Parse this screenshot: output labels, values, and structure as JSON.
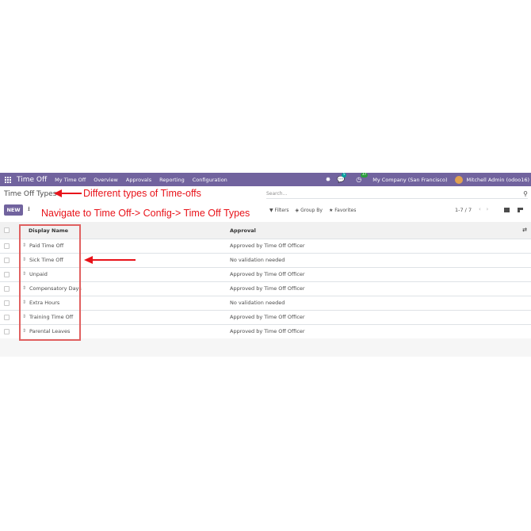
{
  "navbar": {
    "brand": "Time Off",
    "menu": [
      "My Time Off",
      "Overview",
      "Approvals",
      "Reporting",
      "Configuration"
    ],
    "chat_count": "5",
    "activity_count": "37",
    "company": "My Company (San Francisco)",
    "user": "Mitchell Admin (odoo16)"
  },
  "control_panel": {
    "title": "Time Off Types",
    "search_placeholder": "Search...",
    "new_label": "NEW",
    "filters_label": "Filters",
    "group_by_label": "Group By",
    "favorites_label": "Favorites",
    "pager": "1-7 / 7"
  },
  "list": {
    "headers": [
      "Display Name",
      "Approval"
    ],
    "rows": [
      {
        "name": "Paid Time Off",
        "approval": "Approved by Time Off Officer"
      },
      {
        "name": "Sick Time Off",
        "approval": "No validation needed"
      },
      {
        "name": "Unpaid",
        "approval": "Approved by Time Off Officer"
      },
      {
        "name": "Compensatory Days",
        "approval": "Approved by Time Off Officer"
      },
      {
        "name": "Extra Hours",
        "approval": "No validation needed"
      },
      {
        "name": "Training Time Off",
        "approval": "Approved by Time Off Officer"
      },
      {
        "name": "Parental Leaves",
        "approval": "Approved by Time Off Officer"
      }
    ]
  },
  "annotations": {
    "types_note": "Different types of Time-offs",
    "navigate_note": "Navigate to Time Off-> Config-> Time Off Types"
  },
  "colors": {
    "navbar": "#71639e",
    "annotation": "#e8131a"
  }
}
